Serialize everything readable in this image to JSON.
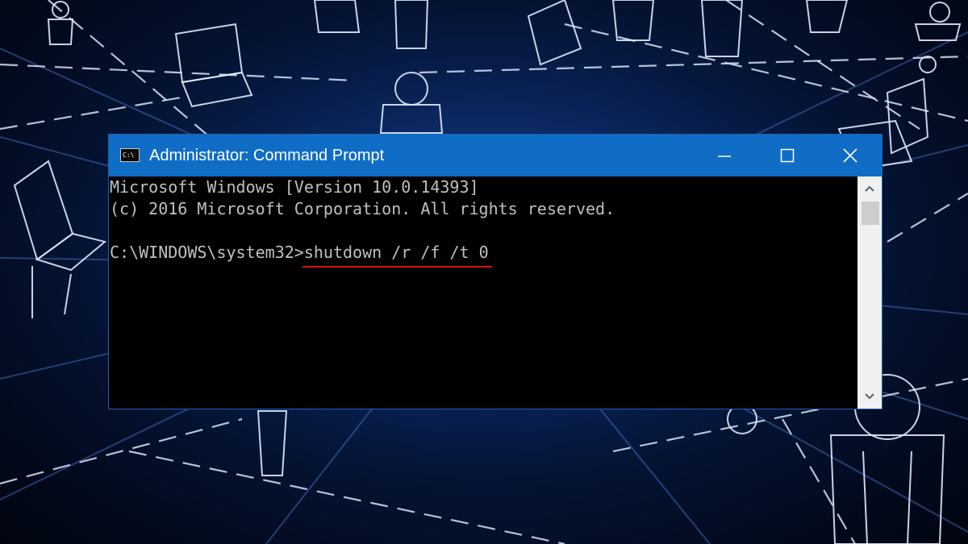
{
  "window": {
    "title": "Administrator: Command Prompt",
    "icon": "cmd-icon",
    "icon_text": "C:\\",
    "controls": [
      "minimize-icon",
      "maximize-icon",
      "close-icon"
    ]
  },
  "console": {
    "lines": [
      "Microsoft Windows [Version 10.0.14393]",
      "(c) 2016 Microsoft Corporation. All rights reserved.",
      ""
    ],
    "prompt": "C:\\WINDOWS\\system32>",
    "command": "shutdown /r /f /t 0"
  },
  "colors": {
    "titlebar": "#0f6dc6",
    "console_bg": "#000000",
    "console_text": "#c0c0c0",
    "underline": "#d41515"
  }
}
